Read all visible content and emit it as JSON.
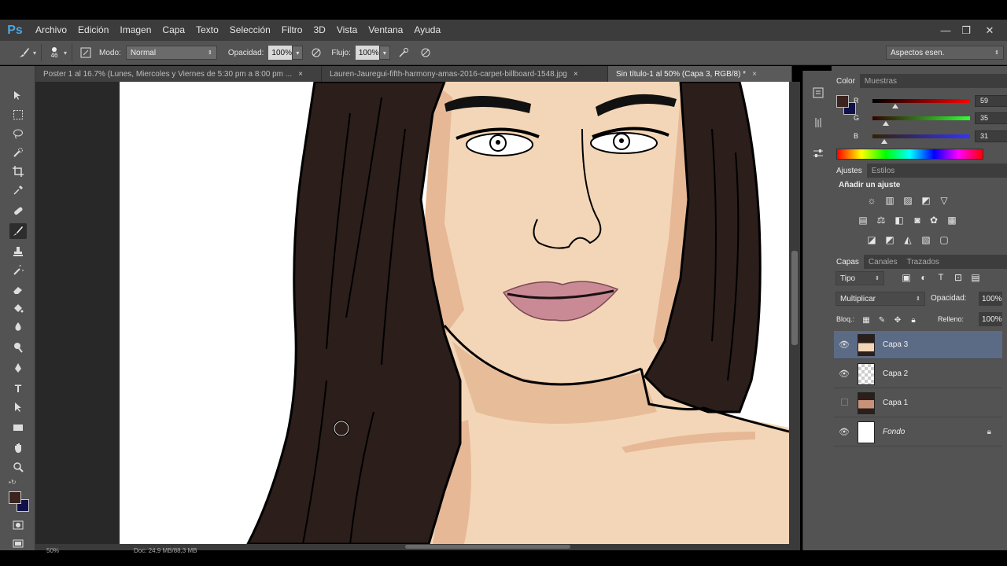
{
  "app": {
    "logo": "Ps"
  },
  "menu": [
    "Archivo",
    "Edición",
    "Imagen",
    "Capa",
    "Texto",
    "Selección",
    "Filtro",
    "3D",
    "Vista",
    "Ventana",
    "Ayuda"
  ],
  "window_controls": {
    "minimize": "—",
    "restore": "❐",
    "close": "✕"
  },
  "options": {
    "brush_size": "46",
    "mode_label": "Modo:",
    "mode_value": "Normal",
    "opacity_label": "Opacidad:",
    "opacity_value": "100%",
    "flow_label": "Flujo:",
    "flow_value": "100%",
    "workspace": "Aspectos esen."
  },
  "tabs": [
    {
      "label": "Poster 1 al 16.7% (Lunes, Miercoles y Viernes de 5:30 pm a 8:00 pm ...",
      "active": false
    },
    {
      "label": "Lauren-Jauregui-fifth-harmony-amas-2016-carpet-billboard-1548.jpg",
      "active": false
    },
    {
      "label": "Sin título-1 al 50% (Capa 3, RGB/8) *",
      "active": true
    }
  ],
  "tab_close": "×",
  "status": {
    "zoom": "50%",
    "doc": "Doc: 24,9 MB/88,3 MB"
  },
  "color_panel": {
    "tabs": [
      "Color",
      "Muestras"
    ],
    "r_label": "R",
    "g_label": "G",
    "b_label": "B",
    "r": "59",
    "g": "35",
    "b": "31",
    "r_level": 0.23,
    "g_level": 0.14,
    "b_level": 0.12,
    "foreground": "#3b231f",
    "background": "#10104a"
  },
  "adjust_panel": {
    "tabs": [
      "Ajustes",
      "Estilos"
    ],
    "title": "Añadir un ajuste"
  },
  "layers_panel": {
    "tabs": [
      "Capas",
      "Canales",
      "Trazados"
    ],
    "filter": "Tipo",
    "blend_mode": "Multiplicar",
    "opacity_label": "Opacidad:",
    "opacity": "100%",
    "lock_label": "Bloq.:",
    "fill_label": "Relleno:",
    "fill": "100%",
    "layers": [
      {
        "name": "Capa 3",
        "selected": true,
        "visible": true
      },
      {
        "name": "Capa 2",
        "selected": false,
        "visible": true
      },
      {
        "name": "Capa 1",
        "selected": false,
        "visible": false
      },
      {
        "name": "Fondo",
        "selected": false,
        "visible": true,
        "locked": true
      }
    ]
  }
}
